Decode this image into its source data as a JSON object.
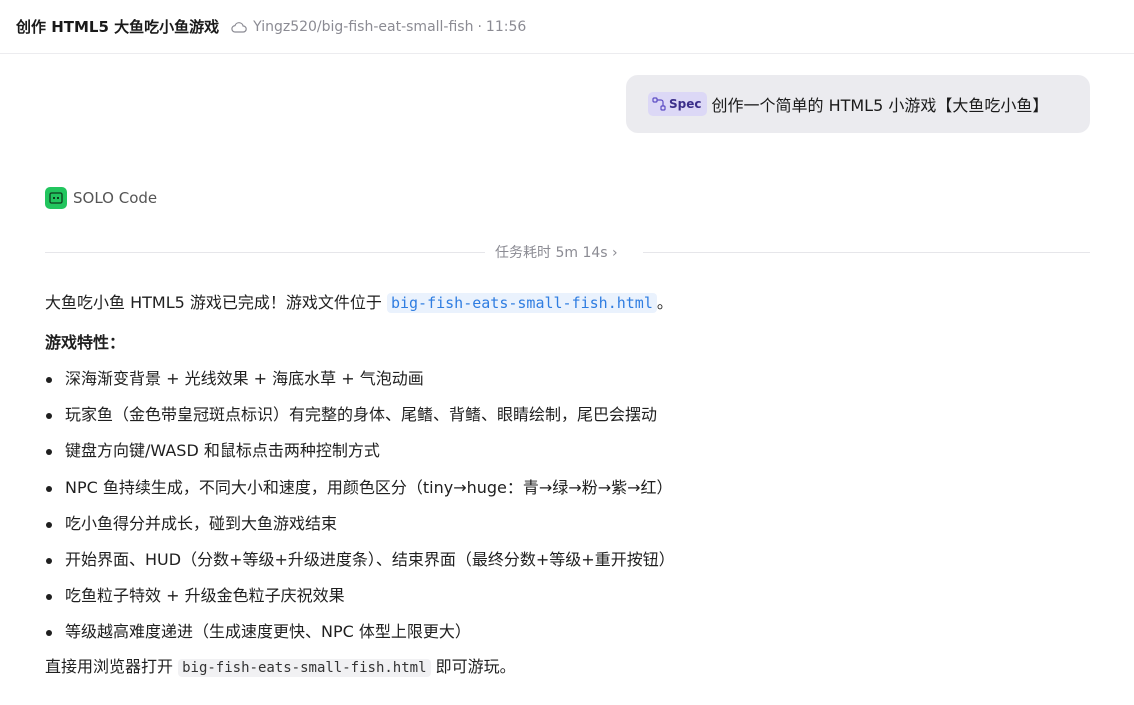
{
  "header": {
    "title": "创作 HTML5 大鱼吃小鱼游戏",
    "repo": "Yingz520/big-fish-eat-small-fish",
    "separator": "·",
    "time": "11:56"
  },
  "user_message": {
    "tag_label": "Spec",
    "text": "创作一个简单的 HTML5 小游戏【大鱼吃小鱼】"
  },
  "agent": {
    "name": "SOLO Code",
    "duration": "任务耗时 5m 14s",
    "duration_chevron": "›"
  },
  "response": {
    "intro_before": "大鱼吃小鱼 HTML5 游戏已完成！游戏文件位于 ",
    "intro_file": "big-fish-eats-small-fish.html",
    "intro_after": "。",
    "features_heading": "游戏特性：",
    "features": [
      "深海渐变背景 + 光线效果 + 海底水草 + 气泡动画",
      "玩家鱼（金色带皇冠斑点标识）有完整的身体、尾鳍、背鳍、眼睛绘制，尾巴会摆动",
      "键盘方向键/WASD 和鼠标点击两种控制方式",
      "NPC 鱼持续生成，不同大小和速度，用颜色区分（tiny→huge：青→绿→粉→紫→红）",
      "吃小鱼得分并成长，碰到大鱼游戏结束",
      "开始界面、HUD（分数+等级+升级进度条）、结束界面（最终分数+等级+重开按钮）",
      "吃鱼粒子特效 + 升级金色粒子庆祝效果",
      "等级越高难度递进（生成速度更快、NPC 体型上限更大）"
    ],
    "outro_before": "直接用浏览器打开 ",
    "outro_file": "big-fish-eats-small-fish.html",
    "outro_after": " 即可游玩。"
  },
  "icons": {
    "repo": "cloud-icon",
    "spec": "spec-flow-icon",
    "agent": "solo-code-icon"
  },
  "colors": {
    "agent_badge": "#22c55e",
    "spec_tag_bg": "#dcd8f6",
    "code_link": "#2f7de1"
  }
}
